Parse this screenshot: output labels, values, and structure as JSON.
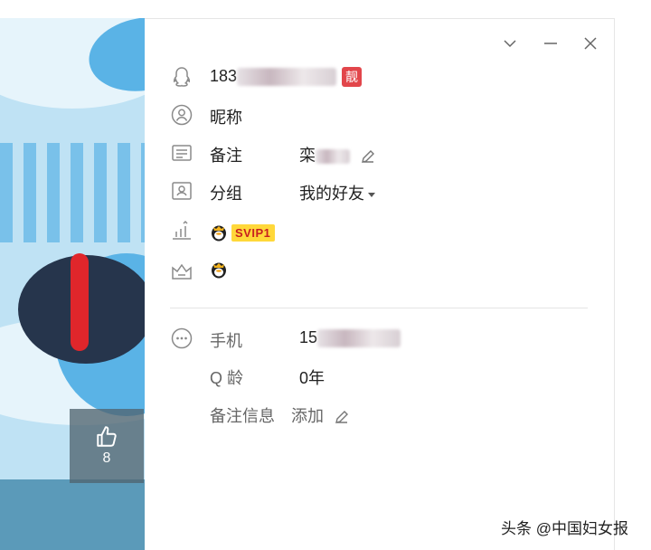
{
  "profile": {
    "qq_number_prefix": "183",
    "pretty_tag": "靓",
    "nickname_label": "昵称",
    "remark_label": "备注",
    "remark_value_prefix": "栾",
    "group_label": "分组",
    "group_value": "我的好友",
    "vip_badge": "SVIP1",
    "phone_label": "手机",
    "phone_prefix": "15",
    "q_age_label": "Q 龄",
    "q_age_value": "0年",
    "remark_info_label": "备注信息",
    "remark_info_action": "添加"
  },
  "sidebar": {
    "like_count": "8"
  },
  "watermark": "头条 @中国妇女报",
  "icons": {
    "minimize": "chevron-down-icon",
    "minimize2": "minus-icon",
    "close": "close-icon",
    "qq": "qq-penguin-icon",
    "nickname": "person-circle-icon",
    "remark": "card-icon",
    "group": "contact-card-icon",
    "vip": "bar-chart-icon",
    "level": "crown-icon",
    "more": "more-dots-icon",
    "edit": "pencil-icon",
    "like": "thumbs-up-icon"
  },
  "colors": {
    "accent_red": "#e2464b",
    "vip_yellow": "#ffd83a",
    "panel_blue": "#bfe2f4"
  }
}
